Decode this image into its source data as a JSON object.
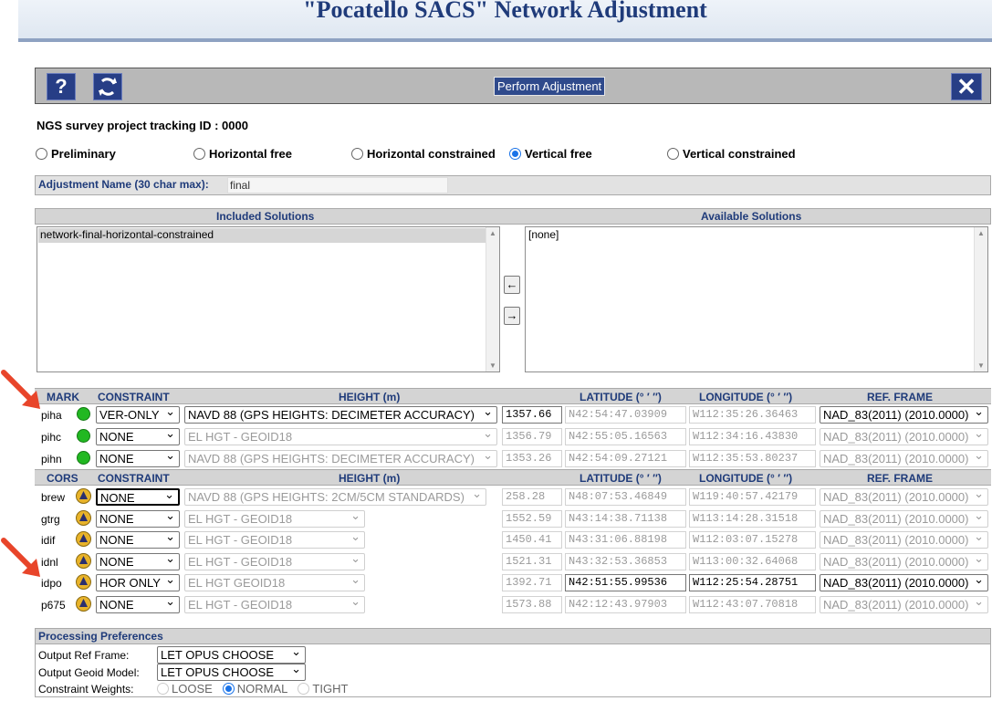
{
  "page": {
    "title": "\"Pocatello SACS\" Network Adjustment"
  },
  "toolbar": {
    "help_label": "?",
    "perform_label": "Perform Adjustment",
    "close_label": "✕"
  },
  "tracking": {
    "text": "NGS survey project tracking ID : 0000"
  },
  "adjustment_types": [
    {
      "label": "Preliminary",
      "selected": false
    },
    {
      "label": "Horizontal free",
      "selected": false
    },
    {
      "label": "Horizontal constrained",
      "selected": false
    },
    {
      "label": "Vertical free",
      "selected": true
    },
    {
      "label": "Vertical constrained",
      "selected": false
    }
  ],
  "adjustment_name": {
    "label": "Adjustment Name (30 char max):",
    "value": "final"
  },
  "solutions": {
    "included_header": "Included Solutions",
    "available_header": "Available Solutions",
    "included": [
      "network-final-horizontal-constrained"
    ],
    "available": [
      "[none]"
    ],
    "move_left": "←",
    "move_right": "→"
  },
  "mark_section": {
    "headers": {
      "mark": "MARK",
      "constraint": "CONSTRAINT",
      "height": "HEIGHT (m)",
      "lat": "LATITUDE (° ′ ″)",
      "lon": "LONGITUDE (° ′ ″)",
      "ref": "REF. FRAME"
    },
    "rows": [
      {
        "name": "piha",
        "constraint": "VER-ONLY",
        "height": "NAVD 88 (GPS HEIGHTS: DECIMETER ACCURACY)",
        "value": "1357.66",
        "lat": "N42:54:47.03909",
        "lon": "W112:35:26.36463",
        "ref": "NAD_83(2011) (2010.0000)"
      },
      {
        "name": "pihc",
        "constraint": "NONE",
        "height": "EL HGT - GEOID18",
        "value": "1356.79",
        "lat": "N42:55:05.16563",
        "lon": "W112:34:16.43830",
        "ref": "NAD_83(2011) (2010.0000)"
      },
      {
        "name": "pihn",
        "constraint": "NONE",
        "height": "NAVD 88 (GPS HEIGHTS: DECIMETER ACCURACY)",
        "value": "1353.26",
        "lat": "N42:54:09.27121",
        "lon": "W112:35:53.80237",
        "ref": "NAD_83(2011) (2010.0000)"
      }
    ]
  },
  "cors_section": {
    "headers": {
      "mark": "CORS",
      "constraint": "CONSTRAINT",
      "height": "HEIGHT (m)",
      "lat": "LATITUDE (° ′ ″)",
      "lon": "LONGITUDE (° ′ ″)",
      "ref": "REF. FRAME"
    },
    "rows": [
      {
        "name": "brew",
        "constraint": "NONE",
        "height": "NAVD 88 (GPS HEIGHTS: 2CM/5CM STANDARDS)",
        "value": "258.28",
        "lat": "N48:07:53.46849",
        "lon": "W119:40:57.42179",
        "ref": "NAD_83(2011) (2010.0000)"
      },
      {
        "name": "gtrg",
        "constraint": "NONE",
        "height": "EL HGT - GEOID18",
        "value": "1552.59",
        "lat": "N43:14:38.71138",
        "lon": "W113:14:28.31518",
        "ref": "NAD_83(2011) (2010.0000)"
      },
      {
        "name": "idif",
        "constraint": "NONE",
        "height": "EL HGT - GEOID18",
        "value": "1450.41",
        "lat": "N43:31:06.88198",
        "lon": "W112:03:07.15278",
        "ref": "NAD_83(2011) (2010.0000)"
      },
      {
        "name": "idnl",
        "constraint": "NONE",
        "height": "EL HGT - GEOID18",
        "value": "1521.31",
        "lat": "N43:32:53.36853",
        "lon": "W113:00:32.64068",
        "ref": "NAD_83(2011) (2010.0000)"
      },
      {
        "name": "idpo",
        "constraint": "HOR ONLY",
        "height": "EL HGT   GEOID18",
        "value": "1392.71",
        "lat": "N42:51:55.99536",
        "lon": "W112:25:54.28751",
        "ref": "NAD_83(2011) (2010.0000)"
      },
      {
        "name": "p675",
        "constraint": "NONE",
        "height": "EL HGT - GEOID18",
        "value": "1573.88",
        "lat": "N42:12:43.97903",
        "lon": "W112:43:07.70818",
        "ref": "NAD_83(2011) (2010.0000)"
      }
    ]
  },
  "preferences": {
    "title": "Processing Preferences",
    "output_ref_frame_label": "Output Ref Frame:",
    "output_ref_frame_value": "LET OPUS CHOOSE",
    "output_geoid_label": "Output Geoid Model:",
    "output_geoid_value": "LET OPUS CHOOSE",
    "weights_label": "Constraint Weights:",
    "weights": [
      "LOOSE",
      "NORMAL",
      "TIGHT"
    ],
    "weights_selected": "NORMAL"
  },
  "colors": {
    "accent": "#2f4a8c",
    "title": "#1f3b7a",
    "mark_dot": "#22b822",
    "cors_cone": "#e8b32a",
    "arrow": "#e8452a"
  }
}
